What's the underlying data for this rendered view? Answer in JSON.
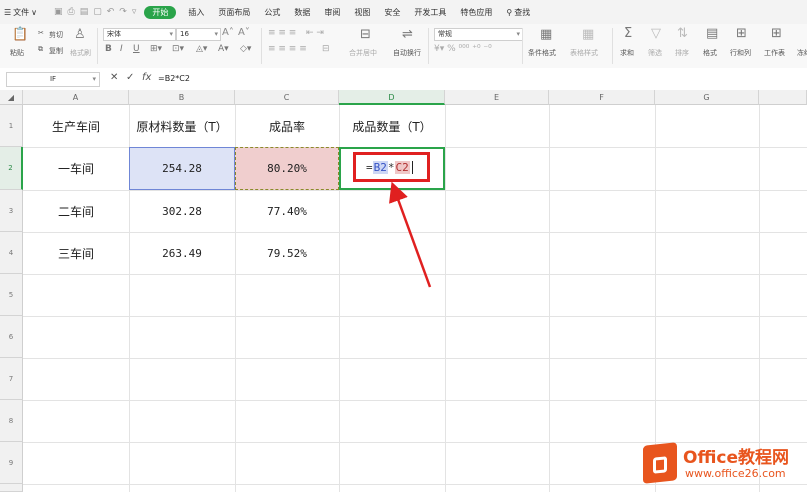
{
  "menubar": {
    "file_label": "文件",
    "tabs": [
      "开始",
      "插入",
      "页面布局",
      "公式",
      "数据",
      "审阅",
      "视图",
      "安全",
      "开发工具",
      "特色应用"
    ],
    "active_tab": "开始",
    "search_label": "查找"
  },
  "ribbon": {
    "paste": "粘贴",
    "cut": "剪切",
    "copy": "复制",
    "format_painter": "格式刷",
    "font_name": "宋体",
    "font_size": "16",
    "merge_center": "合并居中",
    "wrap_text": "自动换行",
    "number_format": "常规",
    "conditional_format": "条件格式",
    "table_style": "表格样式",
    "sum": "求和",
    "filter": "筛选",
    "sort": "排序",
    "format": "格式",
    "row_col": "行和列",
    "worksheet": "工作表",
    "freeze": "冻结"
  },
  "formula_bar": {
    "name_box": "IF",
    "formula": "=B2*C2"
  },
  "columns": [
    "A",
    "B",
    "C",
    "D",
    "E",
    "F",
    "G"
  ],
  "rows": [
    "1",
    "2",
    "3",
    "4",
    "5",
    "6",
    "7",
    "8",
    "9"
  ],
  "table": {
    "headers": [
      "生产车间",
      "原材料数量（T）",
      "成品率",
      "成品数量（T）"
    ],
    "rows": [
      [
        "一车间",
        "254.28",
        "80.20%"
      ],
      [
        "二车间",
        "302.28",
        "77.40%"
      ],
      [
        "三车间",
        "263.49",
        "79.52%"
      ]
    ]
  },
  "edit_cell": {
    "eq": "=",
    "ref1": "B2",
    "op": "*",
    "ref2": "C2"
  },
  "watermark": {
    "brand": "Office教程网",
    "url": "www.office26.com"
  },
  "colors": {
    "accent": "#2aa44a",
    "highlight_red": "#e02020",
    "ref_b": "#dde3f6",
    "ref_c": "#f0cece",
    "watermark": "#e8551e"
  }
}
